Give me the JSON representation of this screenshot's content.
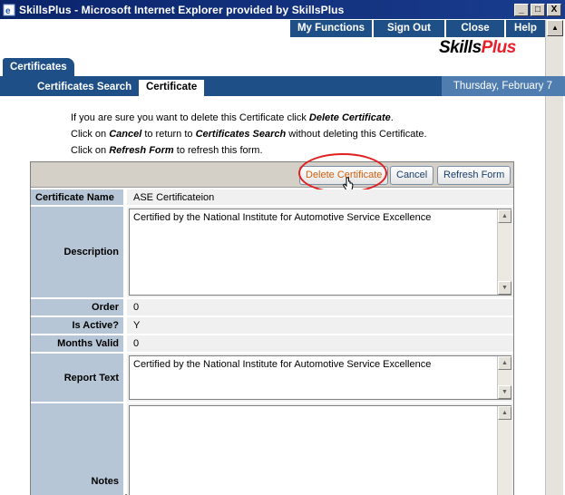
{
  "window": {
    "title": "SkillsPlus - Microsoft Internet Explorer provided by SkillsPlus",
    "controls": {
      "minimize": "_",
      "maximize": "□",
      "close": "X"
    }
  },
  "nav": {
    "items": [
      {
        "label": "My Functions"
      },
      {
        "label": "Sign Out"
      },
      {
        "label": "Close"
      },
      {
        "label": "Help"
      }
    ]
  },
  "logo": {
    "part1": "Skills",
    "part2": "Plus"
  },
  "tabs": {
    "main": "Certificates"
  },
  "subtabs": {
    "search": "Certificates Search",
    "current": "Certificate"
  },
  "date": "Thursday, February 7",
  "instructions": {
    "line1_pre": "If you are sure you want to delete this Certificate click ",
    "line1_em": "Delete Certificate",
    "line1_post": ".",
    "line2_pre": "Click on ",
    "line2_em1": "Cancel",
    "line2_mid": " to return to ",
    "line2_em2": "Certificates Search",
    "line2_post": " without deleting this Certificate.",
    "line3_pre": "Click on ",
    "line3_em": "Refresh Form",
    "line3_post": " to refresh this form."
  },
  "buttons": {
    "delete": "Delete Certificate",
    "cancel": "Cancel",
    "refresh": "Refresh Form"
  },
  "fields": {
    "name": {
      "label": "Certificate Name",
      "value": "ASE Certificateion"
    },
    "description": {
      "label": "Description",
      "value": "Certified by the National Institute for Automotive Service Excellence"
    },
    "order": {
      "label": "Order",
      "value": "0"
    },
    "active": {
      "label": "Is Active?",
      "value": "Y"
    },
    "months": {
      "label": "Months Valid",
      "value": "0"
    },
    "report": {
      "label": "Report Text",
      "value": "Certified by the National Institute for Automotive Service Excellence"
    },
    "notes": {
      "label": "Notes",
      "value": ""
    }
  },
  "colors": {
    "title_bar": "#0a246a",
    "nav_blue": "#1f4f87",
    "label_bg": "#b7c6d6",
    "highlight": "#e02020",
    "logo_red": "#e8202a"
  }
}
